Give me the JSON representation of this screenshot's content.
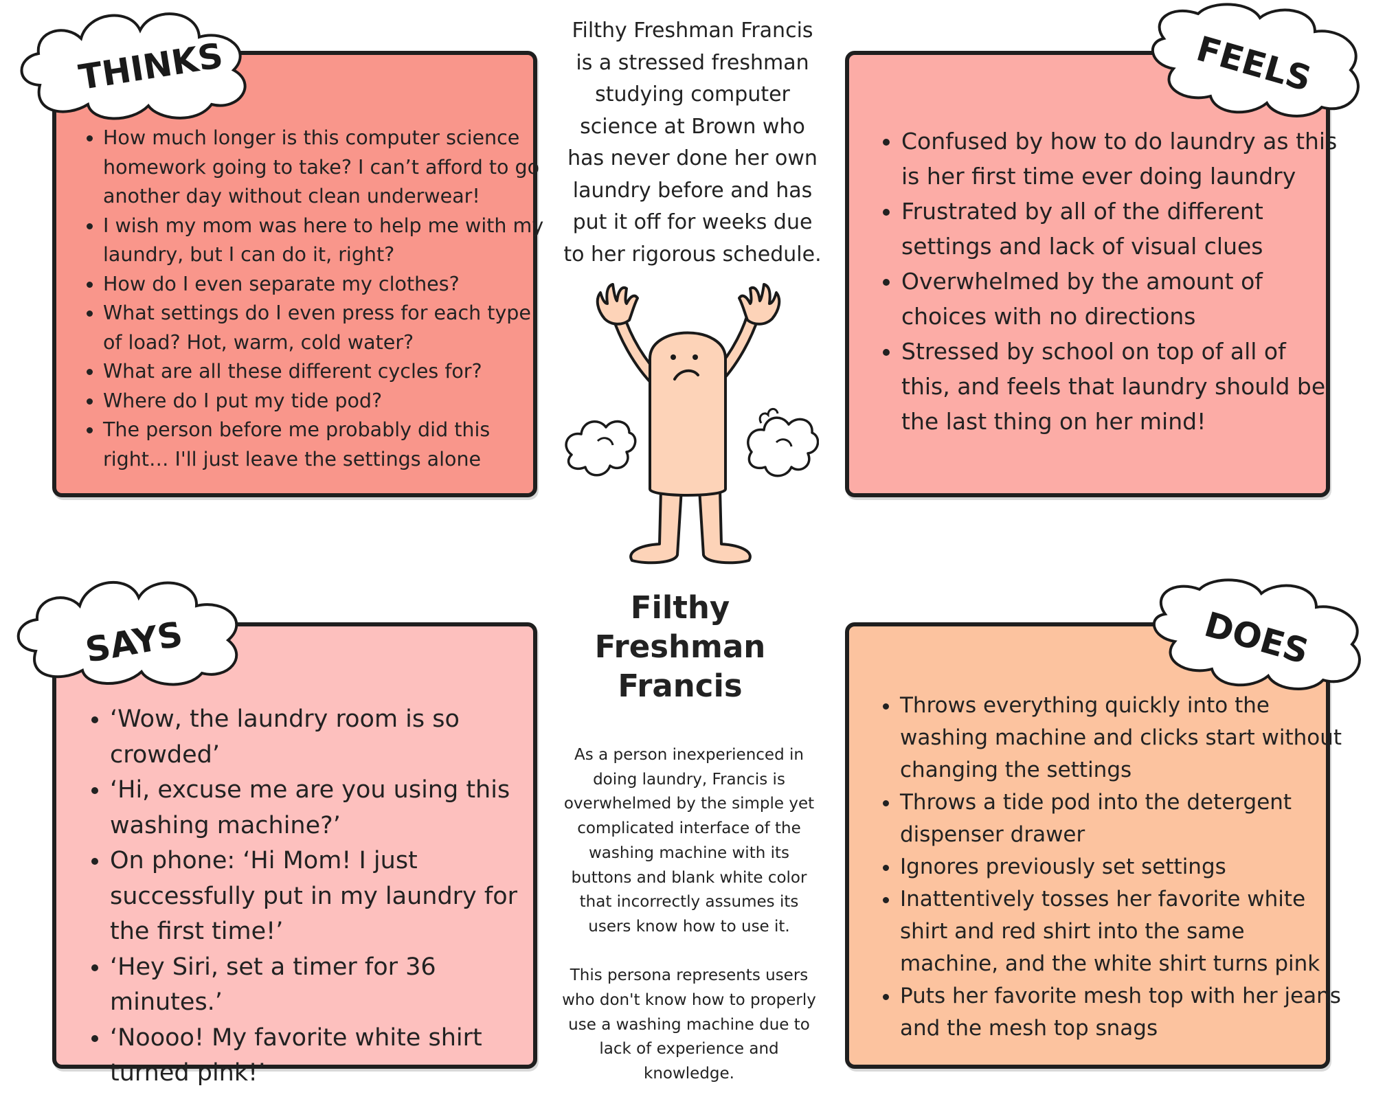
{
  "intro": "Filthy Freshman Francis is a stressed freshman studying computer science at Brown who has never done her own laundry before and has put it off for weeks due to her rigorous schedule.",
  "persona": {
    "name": "Filthy Freshman Francis",
    "description": "As a person inexperienced in doing laundry, Francis is overwhelmed by the simple yet complicated interface of the washing machine with its buttons and blank white color that incorrectly assumes its users know how to use it.\n\nThis persona represents users who don't know how to properly use a washing machine due to lack of experience and knowledge."
  },
  "thinks": {
    "label": "THINKS",
    "color": "#f9968b",
    "items": [
      "How much longer is this computer science homework going to take? I can’t afford to go another day without clean underwear!",
      "I wish my mom was here to help me with my laundry, but I can do it, right?",
      "How do I even separate my clothes?",
      "What settings do I even press for each type of load? Hot, warm, cold water?",
      "What are all these different cycles for?",
      "Where do I put my tide pod?",
      "The person before me probably did this right… I'll just leave the settings alone"
    ]
  },
  "feels": {
    "label": "FEELS",
    "color": "#fcaca6",
    "items": [
      "Confused by how to do laundry as this is her first time ever doing laundry",
      "Frustrated by all of the different settings and lack of visual clues",
      "Overwhelmed by the amount of choices with no directions",
      "Stressed by school on top of all of this, and feels that laundry should be the last thing on her mind!"
    ]
  },
  "says": {
    "label": "SAYS",
    "color": "#fdc0be",
    "items": [
      "‘Wow, the laundry room is so crowded’",
      "‘Hi, excuse me are you using this washing machine?’",
      "On phone: ‘Hi Mom! I just successfully put in my laundry for the first time!’",
      "‘Hey Siri, set a timer for 36 minutes.’",
      "‘Noooo! My favorite white shirt turned pink!’"
    ]
  },
  "does": {
    "label": "DOES",
    "color": "#fcc39f",
    "items": [
      "Throws everything quickly into the washing machine and clicks start without changing the settings",
      "Throws a tide pod into the detergent dispenser drawer",
      "Ignores previously set settings",
      "Inattentively tosses her favorite white shirt and red shirt into the same machine, and the white shirt turns pink",
      "Puts her favorite mesh top with her jeans and the mesh top snags"
    ]
  }
}
